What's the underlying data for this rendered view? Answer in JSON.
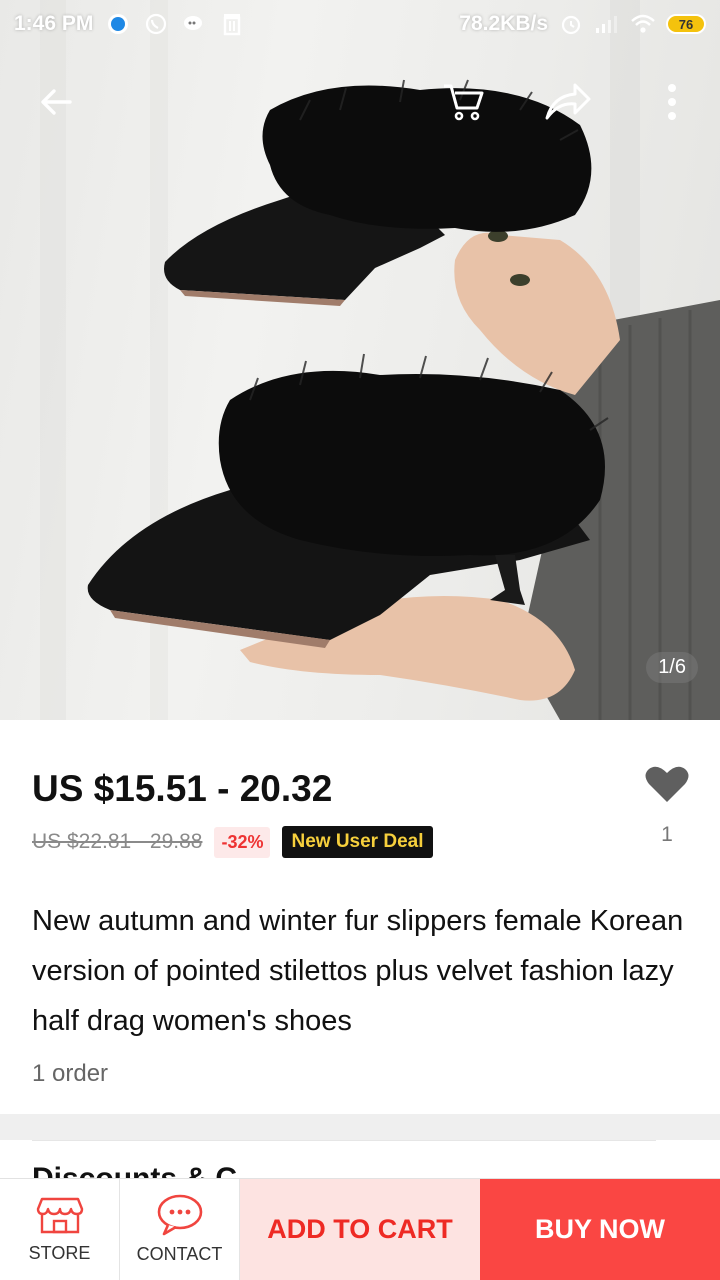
{
  "status_bar": {
    "time": "1:46 PM",
    "speed": "78.2KB/s",
    "battery": "76",
    "icons": [
      "messenger-icon",
      "whatsapp-icon",
      "chat-icon",
      "trash-icon",
      "alarm-icon",
      "signal-icon",
      "wifi-icon",
      "battery-icon"
    ]
  },
  "top_nav": {
    "icons": [
      "back-arrow-icon",
      "cart-icon",
      "share-icon",
      "more-vertical-icon"
    ]
  },
  "gallery": {
    "counter": "1/6"
  },
  "product": {
    "price": "US $15.51 - 20.32",
    "original_price": "US $22.81 - 29.88",
    "discount": "-32%",
    "deal_badge": "New User Deal",
    "wishlist_count": "1",
    "title": "New autumn and winter fur slippers female Korean version of pointed stilettos plus velvet fashion lazy half drag women's shoes",
    "orders": "1 order"
  },
  "next_section": {
    "title": "Discounts & C"
  },
  "bottom_bar": {
    "store_label": "STORE",
    "contact_label": "CONTACT",
    "add_to_cart_label": "ADD TO CART",
    "buy_now_label": "BUY NOW"
  },
  "colors": {
    "accent_red": "#fa4643",
    "cart_bg": "#fde3e1",
    "cart_text": "#ee2a24",
    "deal_text": "#f6cf3c"
  }
}
